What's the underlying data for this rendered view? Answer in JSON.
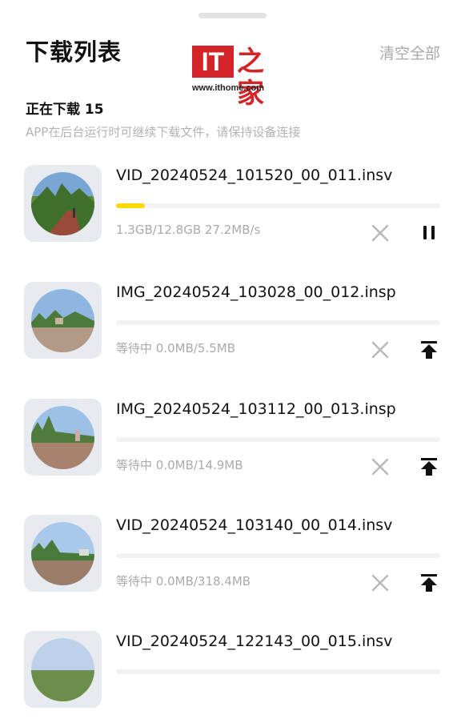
{
  "header": {
    "title": "下载列表",
    "clear_all_label": "清空全部"
  },
  "watermark": {
    "logo_text": "IT",
    "logo_glyph": "之家",
    "url": "www.ithome.com",
    "brand_color": "#d42427"
  },
  "section": {
    "title": "正在下载 15",
    "subtitle": "APP在后台运行时可继续下载文件，请保持设备连接"
  },
  "accent_color": "#ffd800",
  "downloads": [
    {
      "filename": "VID_20240524_101520_00_011.insv",
      "meta": "1.3GB/12.8GB  27.2MB/s",
      "progress": 0.09,
      "action_icon": "pause-icon",
      "cancel_icon": "close-icon"
    },
    {
      "filename": "IMG_20240524_103028_00_012.insp",
      "meta": "等待中 0.0MB/5.5MB",
      "progress": 0,
      "action_icon": "prioritize-top-icon",
      "cancel_icon": "close-icon"
    },
    {
      "filename": "IMG_20240524_103112_00_013.insp",
      "meta": "等待中 0.0MB/14.9MB",
      "progress": 0,
      "action_icon": "prioritize-top-icon",
      "cancel_icon": "close-icon"
    },
    {
      "filename": "VID_20240524_103140_00_014.insv",
      "meta": "等待中 0.0MB/318.4MB",
      "progress": 0,
      "action_icon": "prioritize-top-icon",
      "cancel_icon": "close-icon"
    },
    {
      "filename": "VID_20240524_122143_00_015.insv",
      "meta": "",
      "progress": 0,
      "action_icon": "",
      "cancel_icon": ""
    }
  ]
}
